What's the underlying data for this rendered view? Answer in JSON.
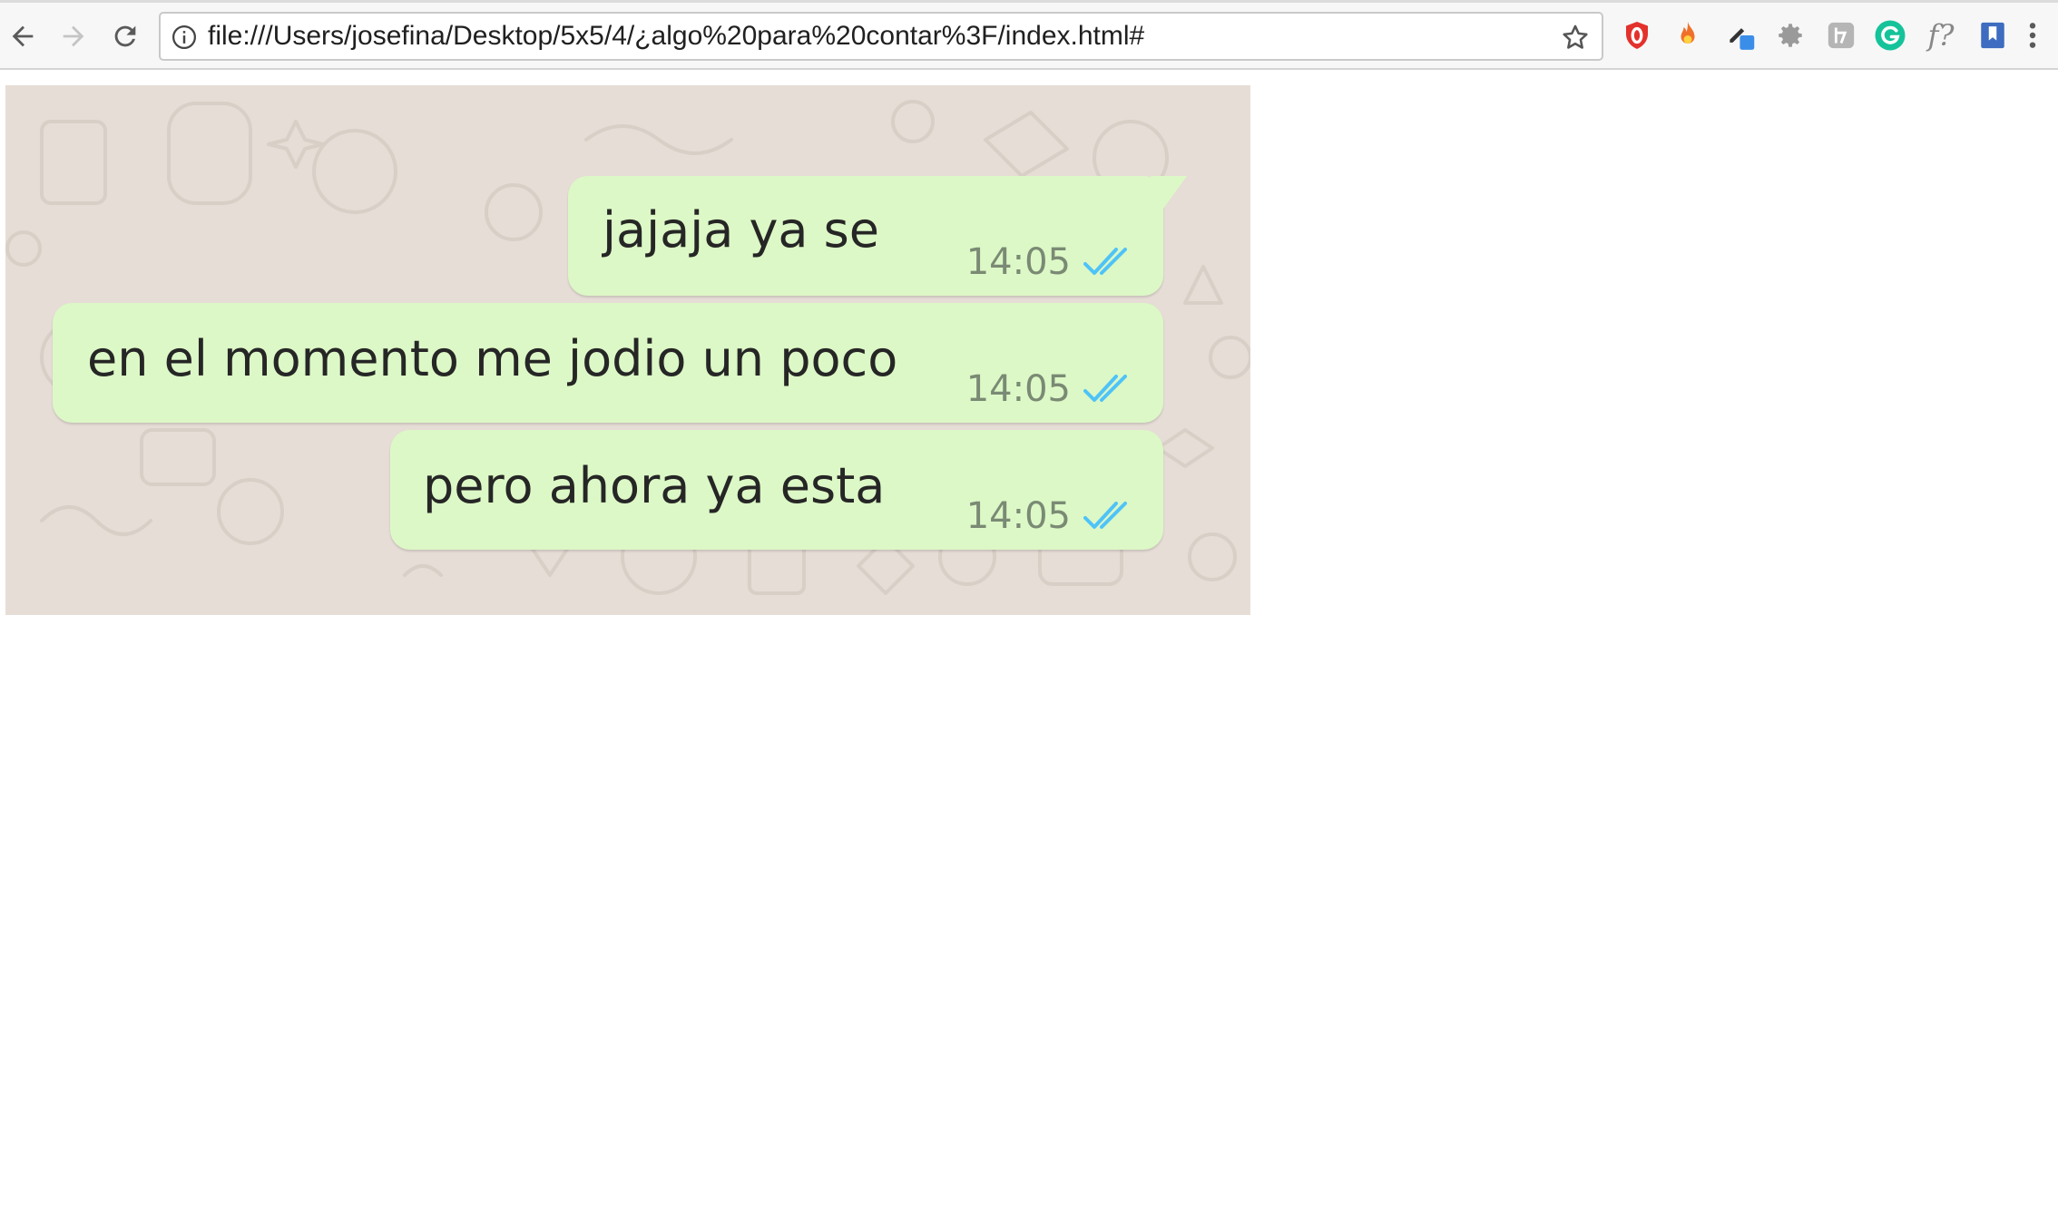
{
  "browser": {
    "url": "file:///Users/josefina/Desktop/5x5/4/¿algo%20para%20contar%3F/index.html#",
    "extensions": [
      {
        "name": "opera-vpn-icon",
        "color": "#e3312c"
      },
      {
        "name": "fire-extension-icon",
        "color": "#f0702a"
      },
      {
        "name": "color-picker-icon",
        "color": "#3b8ee8"
      },
      {
        "name": "settings-gear-icon",
        "color": "#9a9a9a"
      },
      {
        "name": "kana-extension-icon",
        "color": "#b5b5b5"
      },
      {
        "name": "grammarly-icon",
        "color": "#15c39a"
      },
      {
        "name": "font-finder-icon",
        "color": "#888888"
      },
      {
        "name": "bookmark-extension-icon",
        "color": "#3d6cc0"
      }
    ],
    "font_finder_label": "f?"
  },
  "chat": {
    "background_color": "#e6ddd6",
    "bubble_color": "#dcf8c6",
    "tick_color": "#4fc3f7",
    "messages": [
      {
        "text": "jajaja ya se",
        "time": "14:05",
        "status": "read"
      },
      {
        "text": "en el momento me jodio un poco",
        "time": "14:05",
        "status": "read"
      },
      {
        "text": "pero ahora ya esta",
        "time": "14:05",
        "status": "read"
      }
    ]
  }
}
